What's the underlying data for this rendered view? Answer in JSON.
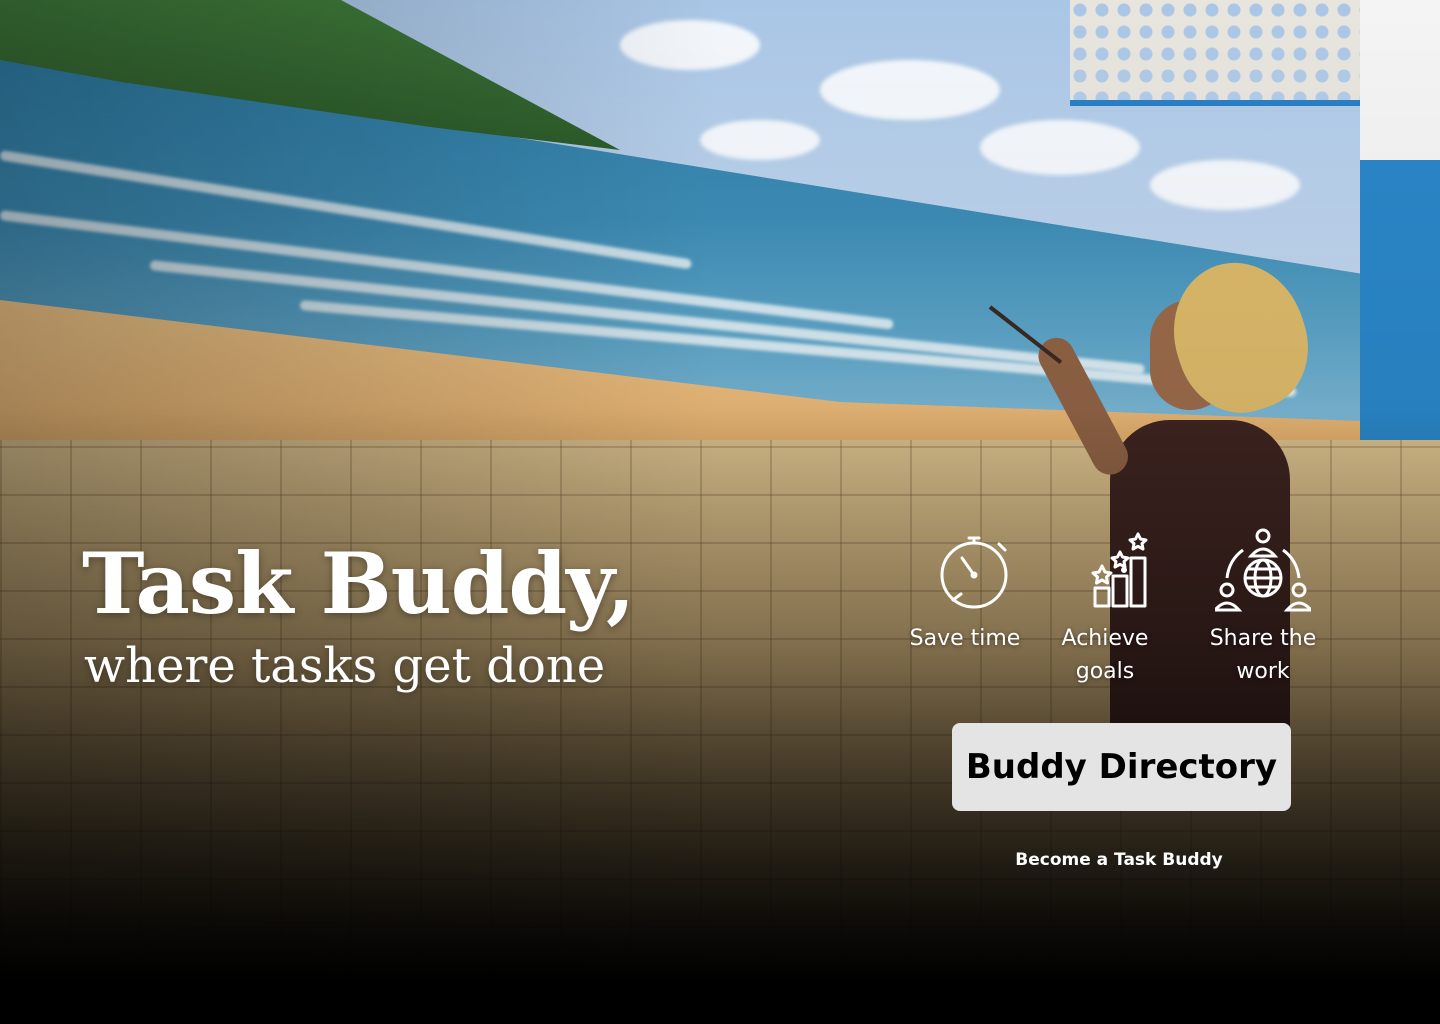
{
  "hero": {
    "title": "Task Buddy,",
    "subtitle": "where tasks get done"
  },
  "features": [
    {
      "label": "Save time",
      "icon": "stopwatch-icon"
    },
    {
      "label": "Achieve goals",
      "icon": "rising-stars-chart-icon"
    },
    {
      "label": "Share the work",
      "icon": "people-globe-icon"
    }
  ],
  "cta": {
    "button_label": "Buddy Directory",
    "link_label": "Become a Task Buddy"
  },
  "colors": {
    "text": "#ffffff",
    "button_bg": "#e4e4e4",
    "button_text": "#000000"
  }
}
